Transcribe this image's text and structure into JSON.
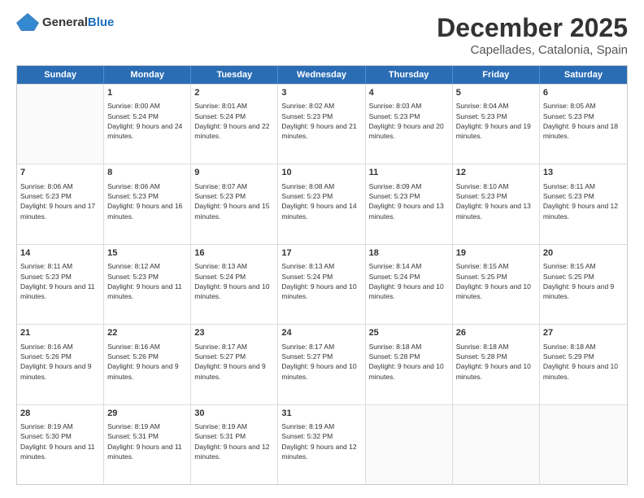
{
  "header": {
    "logo": {
      "general": "General",
      "blue": "Blue"
    },
    "month": "December 2025",
    "location": "Capellades, Catalonia, Spain"
  },
  "calendar": {
    "days": [
      "Sunday",
      "Monday",
      "Tuesday",
      "Wednesday",
      "Thursday",
      "Friday",
      "Saturday"
    ],
    "rows": [
      [
        {
          "day": "",
          "sunrise": "",
          "sunset": "",
          "daylight": ""
        },
        {
          "day": "1",
          "sunrise": "Sunrise: 8:00 AM",
          "sunset": "Sunset: 5:24 PM",
          "daylight": "Daylight: 9 hours and 24 minutes."
        },
        {
          "day": "2",
          "sunrise": "Sunrise: 8:01 AM",
          "sunset": "Sunset: 5:24 PM",
          "daylight": "Daylight: 9 hours and 22 minutes."
        },
        {
          "day": "3",
          "sunrise": "Sunrise: 8:02 AM",
          "sunset": "Sunset: 5:23 PM",
          "daylight": "Daylight: 9 hours and 21 minutes."
        },
        {
          "day": "4",
          "sunrise": "Sunrise: 8:03 AM",
          "sunset": "Sunset: 5:23 PM",
          "daylight": "Daylight: 9 hours and 20 minutes."
        },
        {
          "day": "5",
          "sunrise": "Sunrise: 8:04 AM",
          "sunset": "Sunset: 5:23 PM",
          "daylight": "Daylight: 9 hours and 19 minutes."
        },
        {
          "day": "6",
          "sunrise": "Sunrise: 8:05 AM",
          "sunset": "Sunset: 5:23 PM",
          "daylight": "Daylight: 9 hours and 18 minutes."
        }
      ],
      [
        {
          "day": "7",
          "sunrise": "Sunrise: 8:06 AM",
          "sunset": "Sunset: 5:23 PM",
          "daylight": "Daylight: 9 hours and 17 minutes."
        },
        {
          "day": "8",
          "sunrise": "Sunrise: 8:06 AM",
          "sunset": "Sunset: 5:23 PM",
          "daylight": "Daylight: 9 hours and 16 minutes."
        },
        {
          "day": "9",
          "sunrise": "Sunrise: 8:07 AM",
          "sunset": "Sunset: 5:23 PM",
          "daylight": "Daylight: 9 hours and 15 minutes."
        },
        {
          "day": "10",
          "sunrise": "Sunrise: 8:08 AM",
          "sunset": "Sunset: 5:23 PM",
          "daylight": "Daylight: 9 hours and 14 minutes."
        },
        {
          "day": "11",
          "sunrise": "Sunrise: 8:09 AM",
          "sunset": "Sunset: 5:23 PM",
          "daylight": "Daylight: 9 hours and 13 minutes."
        },
        {
          "day": "12",
          "sunrise": "Sunrise: 8:10 AM",
          "sunset": "Sunset: 5:23 PM",
          "daylight": "Daylight: 9 hours and 13 minutes."
        },
        {
          "day": "13",
          "sunrise": "Sunrise: 8:11 AM",
          "sunset": "Sunset: 5:23 PM",
          "daylight": "Daylight: 9 hours and 12 minutes."
        }
      ],
      [
        {
          "day": "14",
          "sunrise": "Sunrise: 8:11 AM",
          "sunset": "Sunset: 5:23 PM",
          "daylight": "Daylight: 9 hours and 11 minutes."
        },
        {
          "day": "15",
          "sunrise": "Sunrise: 8:12 AM",
          "sunset": "Sunset: 5:23 PM",
          "daylight": "Daylight: 9 hours and 11 minutes."
        },
        {
          "day": "16",
          "sunrise": "Sunrise: 8:13 AM",
          "sunset": "Sunset: 5:24 PM",
          "daylight": "Daylight: 9 hours and 10 minutes."
        },
        {
          "day": "17",
          "sunrise": "Sunrise: 8:13 AM",
          "sunset": "Sunset: 5:24 PM",
          "daylight": "Daylight: 9 hours and 10 minutes."
        },
        {
          "day": "18",
          "sunrise": "Sunrise: 8:14 AM",
          "sunset": "Sunset: 5:24 PM",
          "daylight": "Daylight: 9 hours and 10 minutes."
        },
        {
          "day": "19",
          "sunrise": "Sunrise: 8:15 AM",
          "sunset": "Sunset: 5:25 PM",
          "daylight": "Daylight: 9 hours and 10 minutes."
        },
        {
          "day": "20",
          "sunrise": "Sunrise: 8:15 AM",
          "sunset": "Sunset: 5:25 PM",
          "daylight": "Daylight: 9 hours and 9 minutes."
        }
      ],
      [
        {
          "day": "21",
          "sunrise": "Sunrise: 8:16 AM",
          "sunset": "Sunset: 5:26 PM",
          "daylight": "Daylight: 9 hours and 9 minutes."
        },
        {
          "day": "22",
          "sunrise": "Sunrise: 8:16 AM",
          "sunset": "Sunset: 5:26 PM",
          "daylight": "Daylight: 9 hours and 9 minutes."
        },
        {
          "day": "23",
          "sunrise": "Sunrise: 8:17 AM",
          "sunset": "Sunset: 5:27 PM",
          "daylight": "Daylight: 9 hours and 9 minutes."
        },
        {
          "day": "24",
          "sunrise": "Sunrise: 8:17 AM",
          "sunset": "Sunset: 5:27 PM",
          "daylight": "Daylight: 9 hours and 10 minutes."
        },
        {
          "day": "25",
          "sunrise": "Sunrise: 8:18 AM",
          "sunset": "Sunset: 5:28 PM",
          "daylight": "Daylight: 9 hours and 10 minutes."
        },
        {
          "day": "26",
          "sunrise": "Sunrise: 8:18 AM",
          "sunset": "Sunset: 5:28 PM",
          "daylight": "Daylight: 9 hours and 10 minutes."
        },
        {
          "day": "27",
          "sunrise": "Sunrise: 8:18 AM",
          "sunset": "Sunset: 5:29 PM",
          "daylight": "Daylight: 9 hours and 10 minutes."
        }
      ],
      [
        {
          "day": "28",
          "sunrise": "Sunrise: 8:19 AM",
          "sunset": "Sunset: 5:30 PM",
          "daylight": "Daylight: 9 hours and 11 minutes."
        },
        {
          "day": "29",
          "sunrise": "Sunrise: 8:19 AM",
          "sunset": "Sunset: 5:31 PM",
          "daylight": "Daylight: 9 hours and 11 minutes."
        },
        {
          "day": "30",
          "sunrise": "Sunrise: 8:19 AM",
          "sunset": "Sunset: 5:31 PM",
          "daylight": "Daylight: 9 hours and 12 minutes."
        },
        {
          "day": "31",
          "sunrise": "Sunrise: 8:19 AM",
          "sunset": "Sunset: 5:32 PM",
          "daylight": "Daylight: 9 hours and 12 minutes."
        },
        {
          "day": "",
          "sunrise": "",
          "sunset": "",
          "daylight": ""
        },
        {
          "day": "",
          "sunrise": "",
          "sunset": "",
          "daylight": ""
        },
        {
          "day": "",
          "sunrise": "",
          "sunset": "",
          "daylight": ""
        }
      ]
    ]
  }
}
